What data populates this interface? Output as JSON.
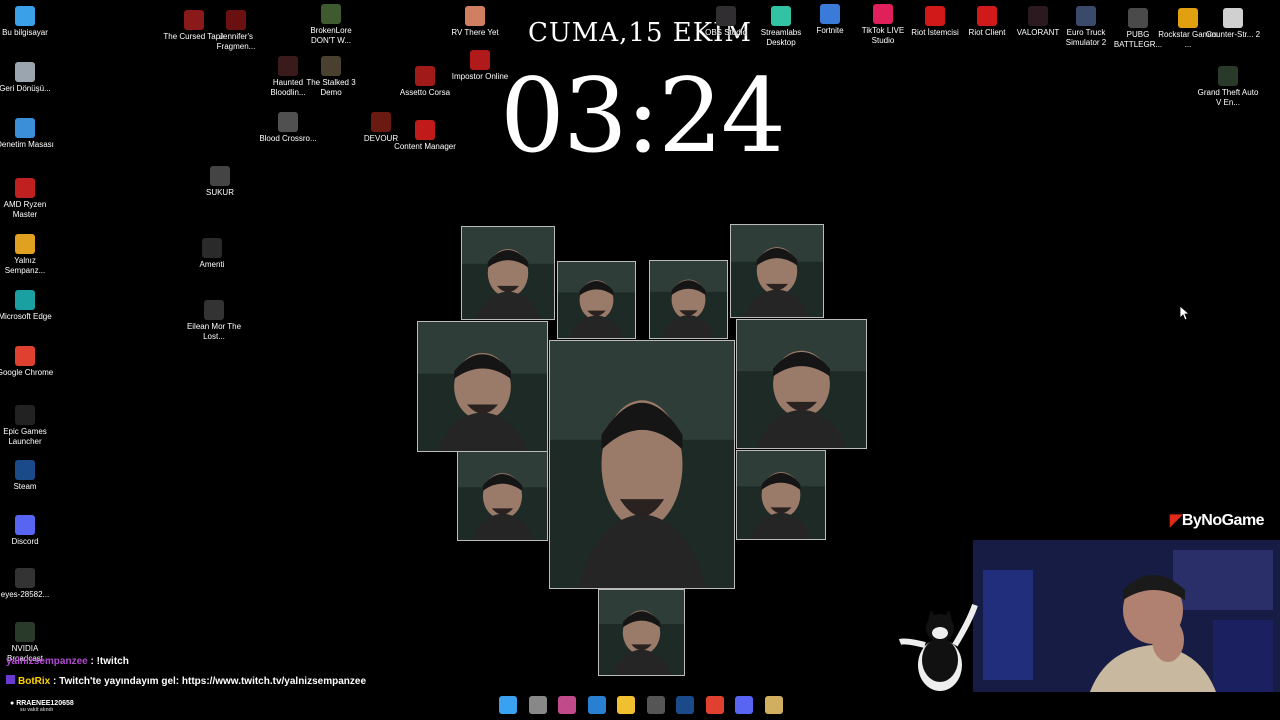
{
  "clock": {
    "date": "CUMA,15 EKİM",
    "time": "03:24"
  },
  "desktop_icons": [
    {
      "label": "Bu bilgisayar",
      "icon": "computer-icon",
      "color": "#3aa0e8"
    },
    {
      "label": "Geri Dönüşü...",
      "icon": "recycle-bin-icon",
      "color": "#9aa5b0"
    },
    {
      "label": "Denetim Masası",
      "icon": "control-panel-icon",
      "color": "#3a8fd8"
    },
    {
      "label": "AMD Ryzen Master",
      "icon": "amd-icon",
      "color": "#c02020"
    },
    {
      "label": "Yalnız Sempanz...",
      "icon": "chrome-icon",
      "color": "#e0a020"
    },
    {
      "label": "Microsoft Edge",
      "icon": "edge-icon",
      "color": "#1aa0a0"
    },
    {
      "label": "Google Chrome",
      "icon": "chrome-icon",
      "color": "#e04030"
    },
    {
      "label": "Epic Games Launcher",
      "icon": "epic-icon",
      "color": "#222"
    },
    {
      "label": "Steam",
      "icon": "steam-icon",
      "color": "#1b4a8a"
    },
    {
      "label": "Discord",
      "icon": "discord-icon",
      "color": "#5865f2"
    },
    {
      "label": "eyes-28582...",
      "icon": "file-icon",
      "color": "#333"
    },
    {
      "label": "NVIDIA Broadcast",
      "icon": "nvidia-icon",
      "color": "#2a3a2a"
    },
    {
      "label": "The Cursed Tape",
      "icon": "game-icon",
      "color": "#8a1a1a"
    },
    {
      "label": "Jennifer's Fragmen...",
      "icon": "game-icon",
      "color": "#6a1010"
    },
    {
      "label": "BrokenLore DON'T W...",
      "icon": "game-icon",
      "color": "#405a30"
    },
    {
      "label": "Haunted Bloodlin...",
      "icon": "game-icon",
      "color": "#3a1a1a"
    },
    {
      "label": "The Stalked 3 Demo",
      "icon": "game-icon",
      "color": "#4a4030"
    },
    {
      "label": "Blood Crossro...",
      "icon": "game-icon",
      "color": "#505050"
    },
    {
      "label": "DEVOUR",
      "icon": "game-icon",
      "color": "#6a1a10"
    },
    {
      "label": "Assetto Corsa",
      "icon": "game-icon",
      "color": "#a01a1a"
    },
    {
      "label": "Content Manager",
      "icon": "game-icon",
      "color": "#c01a1a"
    },
    {
      "label": "RV There Yet",
      "icon": "game-icon",
      "color": "#d08060"
    },
    {
      "label": "Impostor Online",
      "icon": "game-icon",
      "color": "#b01a1a"
    },
    {
      "label": "SUKUR",
      "icon": "file-icon",
      "color": "#444"
    },
    {
      "label": "Amenti",
      "icon": "game-icon",
      "color": "#2a2a2a"
    },
    {
      "label": "Eilean Mor The Lost...",
      "icon": "game-icon",
      "color": "#333"
    },
    {
      "label": "OBS Studio",
      "icon": "obs-icon",
      "color": "#302e31"
    },
    {
      "label": "Streamlabs Desktop",
      "icon": "streamlabs-icon",
      "color": "#31c3a2"
    },
    {
      "label": "Fortnite",
      "icon": "fortnite-icon",
      "color": "#3a7ad8"
    },
    {
      "label": "TikTok LIVE Studio",
      "icon": "tiktok-icon",
      "color": "#e0205a"
    },
    {
      "label": "Riot İstemcisi",
      "icon": "riot-icon",
      "color": "#d01a1a"
    },
    {
      "label": "Riot Client",
      "icon": "riot-icon",
      "color": "#d01a1a"
    },
    {
      "label": "VALORANT",
      "icon": "valorant-icon",
      "color": "#2a1a20"
    },
    {
      "label": "Euro Truck Simulator 2",
      "icon": "ets-icon",
      "color": "#3a4a6a"
    },
    {
      "label": "PUBG BATTLEGR...",
      "icon": "pubg-icon",
      "color": "#4a4a4a"
    },
    {
      "label": "Rockstar Games ...",
      "icon": "rockstar-icon",
      "color": "#e0a010"
    },
    {
      "label": "Counter-Str... 2",
      "icon": "file-icon",
      "color": "#d0d0d0"
    },
    {
      "label": "Grand Theft Auto V En...",
      "icon": "gta-icon",
      "color": "#2a3a2a"
    }
  ],
  "chat": [
    {
      "user": "yalnizsempanzee",
      "message": " : !twitch",
      "user_color": "#b04ad0"
    },
    {
      "user": "BotRix",
      "message": " : Twitch'te yayındayım gel: https://www.twitch.tv/yalnizsempanzee",
      "user_color": "#ffd400"
    }
  ],
  "stream": {
    "brand": "ByNoGame",
    "follower_name": "RRAENEE120658",
    "follower_sub": "su vakit alındı"
  },
  "taskbar_icons": [
    {
      "name": "windows-start-icon",
      "color": "#3aa0f0"
    },
    {
      "name": "task-view-icon",
      "color": "#888"
    },
    {
      "name": "snipping-tool-icon",
      "color": "#c04a8a"
    },
    {
      "name": "photos-icon",
      "color": "#2a80d0"
    },
    {
      "name": "file-explorer-icon",
      "color": "#f0c030"
    },
    {
      "name": "obs-icon",
      "color": "#555"
    },
    {
      "name": "steam-icon",
      "color": "#1b4a8a"
    },
    {
      "name": "chrome-icon",
      "color": "#e04030"
    },
    {
      "name": "discord-icon",
      "color": "#5865f2"
    },
    {
      "name": "app-icon",
      "color": "#d0b060"
    }
  ]
}
